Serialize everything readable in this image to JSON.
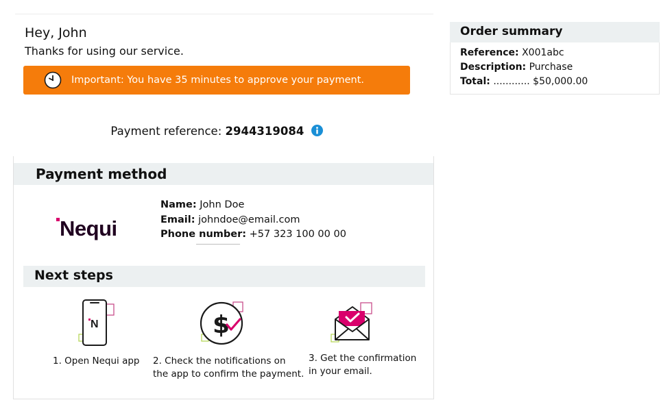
{
  "header": {
    "greeting": "Hey, John",
    "thanks": "Thanks for using our service."
  },
  "alert": {
    "text": "Important: You have 35 minutes to approve your payment.",
    "icon": "clock-icon",
    "color": "#f57c0b"
  },
  "payment_reference": {
    "label": "Payment reference:",
    "value": "2944319084",
    "icon": "info-icon",
    "icon_color": "#1a8fd6"
  },
  "payment_method": {
    "title": "Payment method",
    "logo_text": "Nequi",
    "brand_color": "#d9006c",
    "name_label": "Name:",
    "name_value": "John Doe",
    "email_label": "Email:",
    "email_value": "johndoe@email.com",
    "phone_label": "Phone number:",
    "phone_value": "+57 323 100 00 00"
  },
  "next_steps": {
    "title": "Next steps",
    "steps": [
      {
        "line1": "1. Open Nequi app",
        "line2": "",
        "icon": "phone-app-icon"
      },
      {
        "line1": "2. Check the notifications on",
        "line2": "the app to confirm the payment.",
        "icon": "dollar-check-icon"
      },
      {
        "line1": "3. Get the confirmation",
        "line2": "in your email.",
        "icon": "envelope-check-icon"
      }
    ]
  },
  "order_summary": {
    "title": "Order summary",
    "reference_label": "Reference:",
    "reference_value": "X001abc",
    "description_label": "Description:",
    "description_value": "Purchase",
    "total_label": "Total:",
    "total_value": "............ $50,000.00"
  }
}
